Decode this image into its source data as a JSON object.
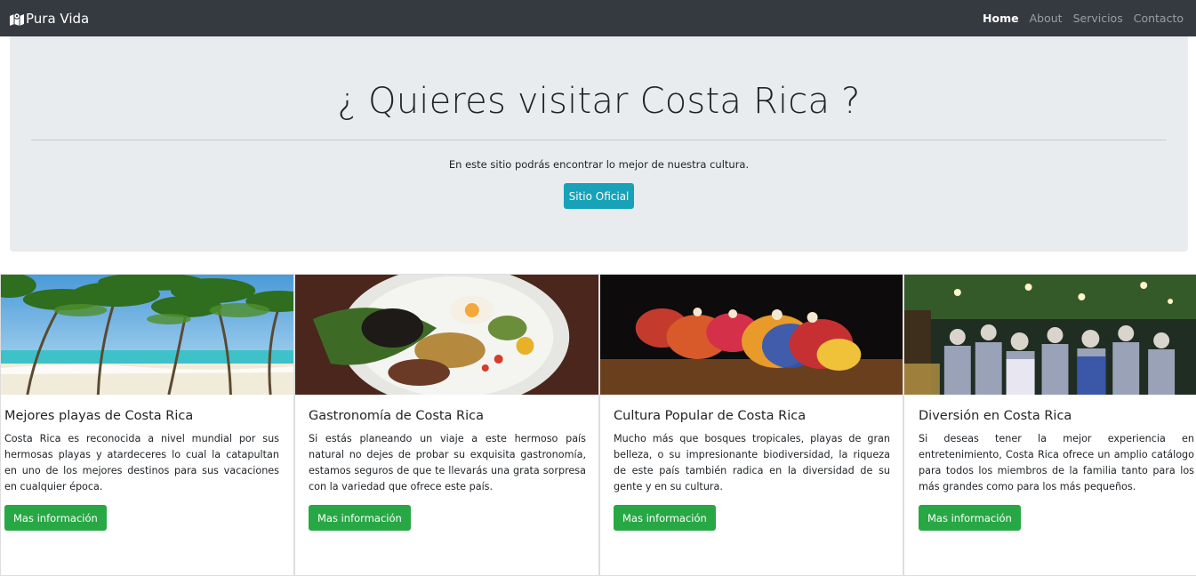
{
  "navbar": {
    "brand": "Pura Vida",
    "brand_icon": "map-icon",
    "links": [
      {
        "label": "Home",
        "active": true
      },
      {
        "label": "About",
        "active": false
      },
      {
        "label": "Servicios",
        "active": false
      },
      {
        "label": "Contacto",
        "active": false
      }
    ]
  },
  "jumbotron": {
    "title": "¿ Quieres visitar Costa Rica ?",
    "lead": "En este sitio podrás encontrar lo mejor de nuestra cultura.",
    "button_label": "Sitio Oficial"
  },
  "cards": [
    {
      "title": "Mejores playas de Costa Rica",
      "text": "Costa Rica es reconocida a nivel mundial por sus hermosas playas y atardeceres lo cual la catapultan en uno de los mejores destinos para sus vacaciones en cualquier época.",
      "button_label": "Mas información",
      "image": "beach-palm-trees"
    },
    {
      "title": "Gastronomía de Costa Rica",
      "text": "Si estás planeando un viaje a este hermoso país natural no dejes de probar su exquisita gastronomía, estamos seguros de que te llevarás una grata sorpresa con la variedad que ofrece este país.",
      "button_label": "Mas información",
      "image": "typical-dish-plate"
    },
    {
      "title": "Cultura Popular de Costa Rica",
      "text": "Mucho más que bosques tropicales, playas de gran belleza, o su impresionante biodiversidad, la riqueza de este país también radica en la diversidad de su gente y en su cultura.",
      "button_label": "Mas información",
      "image": "folk-dancers"
    },
    {
      "title": "Diversión en Costa Rica",
      "text": "Si deseas tener la mejor experiencia en entretenimiento, Costa Rica ofrece un amplio catálogo para todos los miembros de la familia tanto para los más grandes como para los más pequeños.",
      "button_label": "Mas información",
      "image": "night-crowd"
    }
  ],
  "colors": {
    "navbar": "#343a40",
    "jumbotron": "#e9ecef",
    "info_button": "#17a2b8",
    "success_button": "#28a745"
  }
}
